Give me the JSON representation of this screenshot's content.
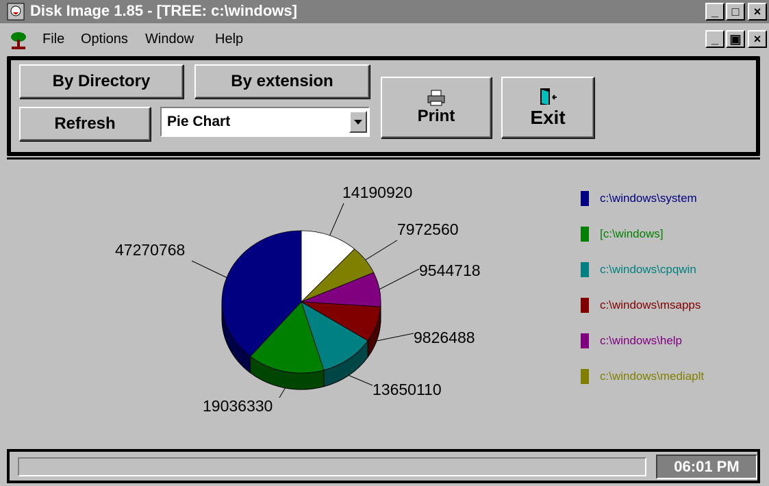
{
  "window": {
    "title": "Disk Image 1.85 - [TREE: c:\\windows]",
    "controls": {
      "minimize": "_",
      "maximize": "□",
      "close": "×",
      "restore": "▣"
    }
  },
  "menu": [
    "File",
    "Options",
    "Window",
    "Help"
  ],
  "toolbar": {
    "by_directory": "By Directory",
    "by_extension": "By extension",
    "refresh": "Refresh",
    "chart_type_selected": "Pie Chart",
    "print": "Print",
    "exit": "Exit"
  },
  "chart_data": {
    "type": "pie",
    "slices": [
      {
        "label": "c:\\windows\\system",
        "value": 47270768,
        "color": "#000080"
      },
      {
        "label": "[c:\\windows]",
        "value": 19036330,
        "color": "#008000"
      },
      {
        "label": "c:\\windows\\cpqwin",
        "value": 13650110,
        "color": "#008080"
      },
      {
        "label": "c:\\windows\\msapps",
        "value": 9826488,
        "color": "#800000"
      },
      {
        "label": "c:\\windows\\help",
        "value": 9544718,
        "color": "#800080"
      },
      {
        "label": "c:\\windows\\mediaplt",
        "value": 7972560,
        "color": "#808000"
      },
      {
        "label": "",
        "value": 14190920,
        "color": "#ffffff"
      }
    ],
    "legend_position": "right"
  },
  "status": {
    "message": "",
    "clock": "06:01 PM"
  }
}
